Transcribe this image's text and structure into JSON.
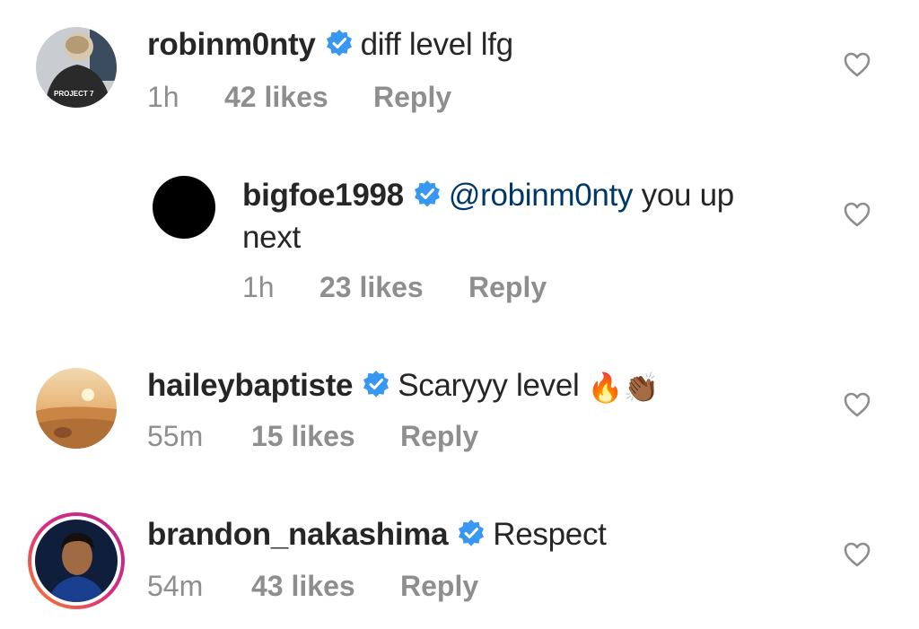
{
  "comments": [
    {
      "username": "robinm0nty",
      "text": "diff level lfg",
      "time": "1h",
      "likes": "42 likes",
      "reply": "Reply",
      "avatar_text": "PROJECT 7"
    },
    {
      "username": "bigfoe1998",
      "mention": "@robinm0nty",
      "text_line1": " you up",
      "text_line2": "next",
      "time": "1h",
      "likes": "23 likes",
      "reply": "Reply"
    },
    {
      "username": "haileybaptiste",
      "text": "Scaryyy level ",
      "emoji_fire": "🔥",
      "emoji_clap": "👏🏾",
      "time": "55m",
      "likes": "15 likes",
      "reply": "Reply"
    },
    {
      "username": "brandon_nakashima",
      "text": "Respect",
      "time": "54m",
      "likes": "43 likes",
      "reply": "Reply"
    }
  ],
  "colors": {
    "text": "#262626",
    "secondary": "#8e8e8e",
    "verified": "#3897f0",
    "mention": "#00376b",
    "story_ring_start": "#f58529",
    "story_ring_end": "#dd2a7b"
  },
  "icons": {
    "verified": "verified-badge-icon",
    "like": "heart-outline-icon"
  }
}
